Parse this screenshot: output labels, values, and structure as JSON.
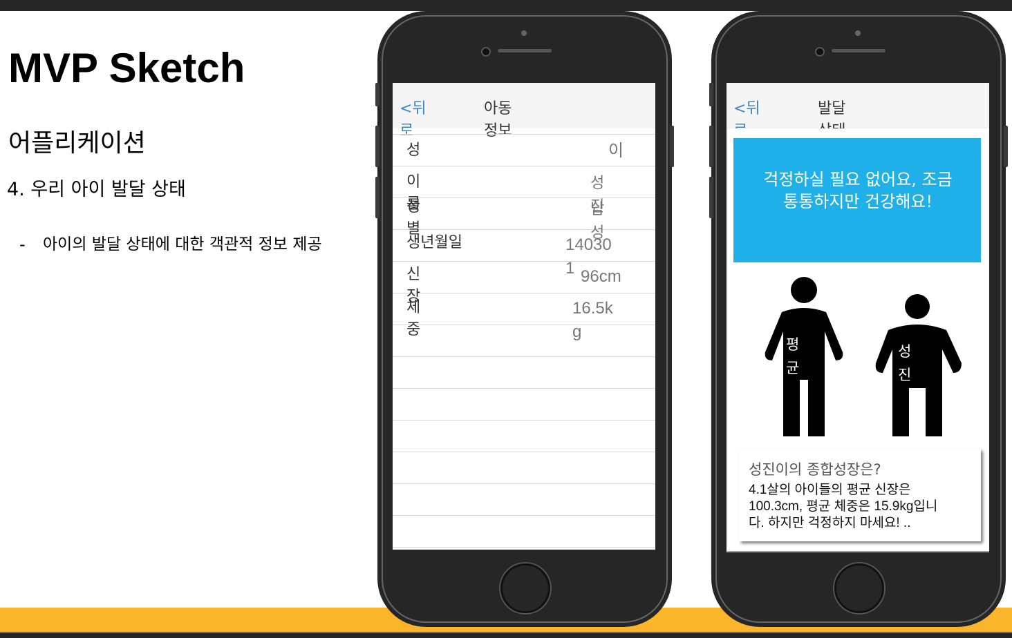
{
  "slide": {
    "title": "MVP Sketch",
    "section": "어플리케이션",
    "point": "4. 우리 아이 발달 상태",
    "bullet_dash": "-",
    "bullet": "아이의 발달 상태에 대한 객관적 정보 제공"
  },
  "phone1": {
    "back_label": "<뒤로",
    "nav_title": "아동정보",
    "rows": [
      {
        "label": "성",
        "value": "이"
      },
      {
        "label": "이름",
        "value": "성진"
      },
      {
        "label": "성별",
        "value": "남성"
      },
      {
        "label": "생년월일",
        "value": "140301"
      },
      {
        "label": "신장",
        "value": "96cm"
      },
      {
        "label": "체중",
        "value": "16.5kg"
      }
    ]
  },
  "phone2": {
    "back_label": "<뒤로",
    "nav_title": "발달상태",
    "banner": "걱정하실 필요 없어요, 조금 통통하지만 건강해요!",
    "figure_average_label": "평균",
    "figure_child_label": "성진",
    "summary_title": "성진이의 종합성장은?",
    "summary_body": "4.1살의 아이들의 평균 신장은 100.3cm, 평균 체중은 15.9kg입니다. 하지만 걱정하지 마세요! .."
  },
  "colors": {
    "accent_bar": "#fbb52b",
    "dark_bar": "#262626",
    "banner": "#1fb0ea",
    "link": "#3a86c8"
  }
}
